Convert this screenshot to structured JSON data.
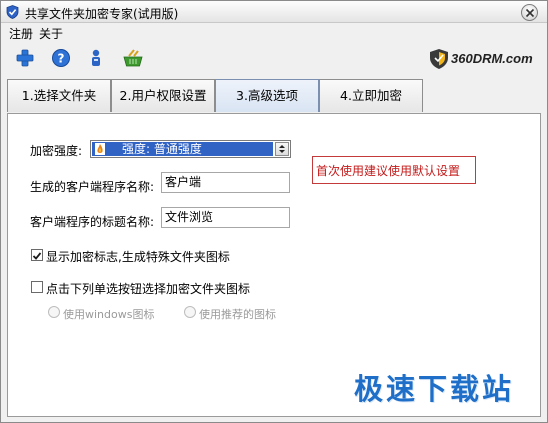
{
  "window": {
    "title": "共享文件夹加密专家(试用版)"
  },
  "menu": {
    "register": "注册",
    "about": "关于"
  },
  "brand": {
    "text": "360DRM.com"
  },
  "tabs": [
    {
      "label": "1.选择文件夹"
    },
    {
      "label": "2.用户权限设置"
    },
    {
      "label": "3.高级选项",
      "active": true
    },
    {
      "label": "4.立即加密"
    }
  ],
  "form": {
    "strength_label": "加密强度:",
    "strength_value": "强度: 普通强度",
    "client_name_label": "生成的客户端程序名称:",
    "client_name_value": "客户端",
    "title_name_label": "客户端程序的标题名称:",
    "title_name_value": "文件浏览",
    "hint": "首次使用建议使用默认设置",
    "show_mark_label": "显示加密标志,生成特殊文件夹图标",
    "show_mark_checked": true,
    "choose_icon_label": "点击下列单选按钮选择加密文件夹图标",
    "choose_icon_checked": false,
    "radio_windows_label": "使用windows图标",
    "radio_recommended_label": "使用推荐的图标"
  },
  "watermark": "极速下载站",
  "colors": {
    "accent": "#3163c5",
    "hint_red": "#c41a1a",
    "watermark_blue": "#1f6fc8"
  }
}
